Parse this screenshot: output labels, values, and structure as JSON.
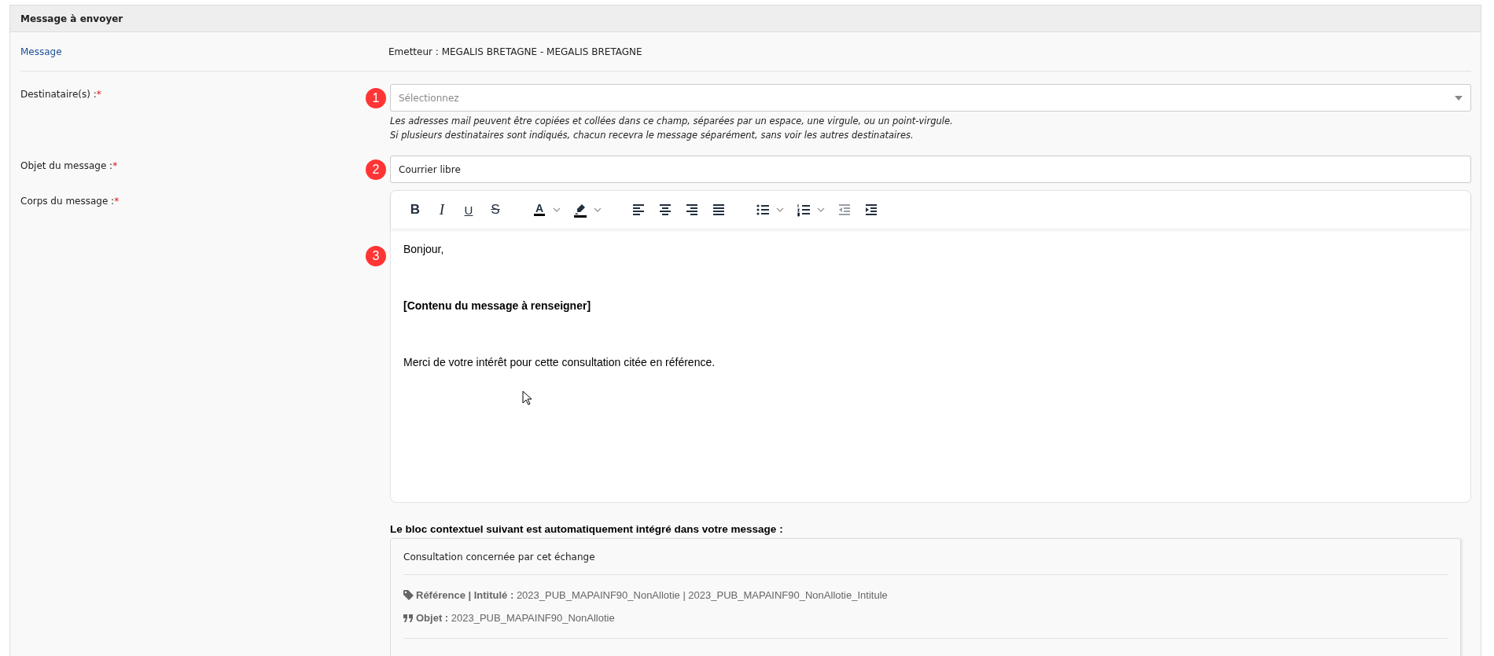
{
  "panel": {
    "title": "Message à envoyer"
  },
  "message_row": {
    "label": "Message",
    "sender": "Emetteur : MEGALIS BRETAGNE - MEGALIS BRETAGNE"
  },
  "fields": [
    {
      "kind": "select",
      "label": "Destinataire(s) :",
      "required_mark": "*",
      "badge": "1",
      "placeholder": "Sélectionnez",
      "hints": [
        "Les adresses mail peuvent être copiées et collées dans ce champ, séparées par un espace, une virgule, ou un point-virgule.",
        "Si plusieurs destinataires sont indiqués, chacun recevra le message séparément, sans voir les autres destinataires."
      ]
    },
    {
      "kind": "text",
      "label": "Objet du message :",
      "required_mark": "*",
      "badge": "2",
      "value": "Courrier libre"
    },
    {
      "kind": "editor",
      "label": "Corps du message :",
      "required_mark": "*",
      "badge": "3",
      "toolbar_groups": [
        {
          "items": [
            {
              "kind": "bold",
              "glyph": "B",
              "dropdown": false,
              "disabled": false
            },
            {
              "kind": "italic",
              "glyph": "I",
              "dropdown": false,
              "disabled": false
            },
            {
              "kind": "underline",
              "glyph": "U",
              "dropdown": false,
              "disabled": false
            },
            {
              "kind": "strike",
              "glyph": "S",
              "dropdown": false,
              "disabled": false
            }
          ]
        },
        {
          "items": [
            {
              "kind": "text-color",
              "glyph": "A",
              "dropdown": true,
              "disabled": false
            },
            {
              "kind": "highlight",
              "dropdown": true,
              "disabled": false
            }
          ]
        },
        {
          "items": [
            {
              "kind": "align-left",
              "dropdown": false,
              "disabled": false
            },
            {
              "kind": "align-center",
              "dropdown": false,
              "disabled": false
            },
            {
              "kind": "align-right",
              "dropdown": false,
              "disabled": false
            },
            {
              "kind": "justify",
              "dropdown": false,
              "disabled": false
            }
          ]
        },
        {
          "items": [
            {
              "kind": "bullet-list",
              "dropdown": true,
              "disabled": false
            },
            {
              "kind": "numbered-list",
              "dropdown": true,
              "disabled": false
            },
            {
              "kind": "outdent",
              "dropdown": false,
              "disabled": true
            },
            {
              "kind": "indent",
              "dropdown": false,
              "disabled": false
            }
          ]
        }
      ],
      "paragraphs": [
        {
          "text": "Bonjour,",
          "bold": false
        },
        {
          "text": "[Contenu du message à renseigner]",
          "bold": true
        },
        {
          "text": "Merci de votre intérêt pour cette consultation citée en référence.",
          "bold": false
        }
      ]
    }
  ],
  "context": {
    "intro": "Le bloc contextuel suivant est automatiquement intégré dans votre message :",
    "heading": "Consultation concernée par cet échange",
    "items": [
      {
        "kind": "tag",
        "label": "Référence | Intitulé :",
        "value": "2023_PUB_MAPAINF90_NonAllotie | 2023_PUB_MAPAINF90_NonAllotie_Intitule"
      },
      {
        "kind": "quote",
        "label": "Objet :",
        "value": "2023_PUB_MAPAINF90_NonAllotie"
      }
    ]
  }
}
